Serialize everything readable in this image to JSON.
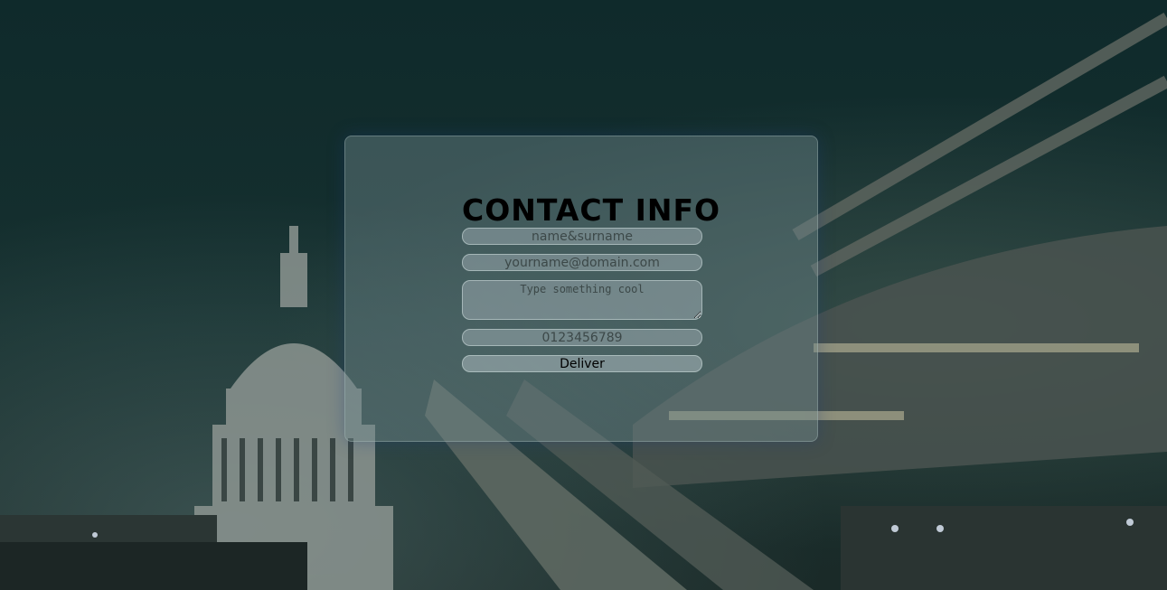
{
  "contact": {
    "title": "CONTACT INFO",
    "name_placeholder": "name&surname",
    "email_placeholder": "yourname@domain.com",
    "message_placeholder": "Type something cool",
    "phone_placeholder": "0123456789",
    "submit_label": "Deliver"
  },
  "colors": {
    "background": "#16302f",
    "panel": "#6e878c",
    "title_text": "#000000"
  }
}
